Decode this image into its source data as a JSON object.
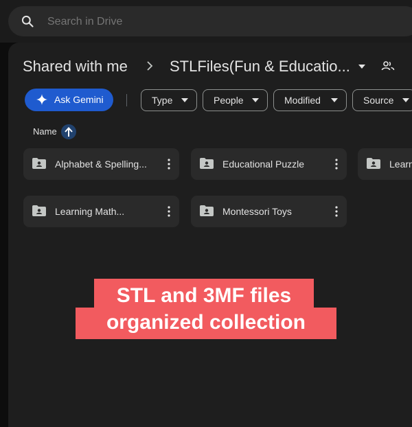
{
  "search": {
    "placeholder": "Search in Drive"
  },
  "breadcrumb": {
    "root": "Shared with me",
    "current": "STLFiles(Fun & Educatio..."
  },
  "toolbar": {
    "ask_gemini": "Ask Gemini",
    "filters": [
      "Type",
      "People",
      "Modified",
      "Source"
    ]
  },
  "list_header": {
    "name": "Name",
    "sort": "ascending"
  },
  "folders": [
    "Alphabet & Spelling...",
    "Educational Puzzle",
    "Learn",
    "Learning Math...",
    "Montessori Toys"
  ],
  "banner": {
    "line1": "STL and 3MF files",
    "line2": "organized collection"
  },
  "colors": {
    "accent": "#1f5bcf",
    "banner": "#f25b5f",
    "panel": "#1e1e1e"
  }
}
